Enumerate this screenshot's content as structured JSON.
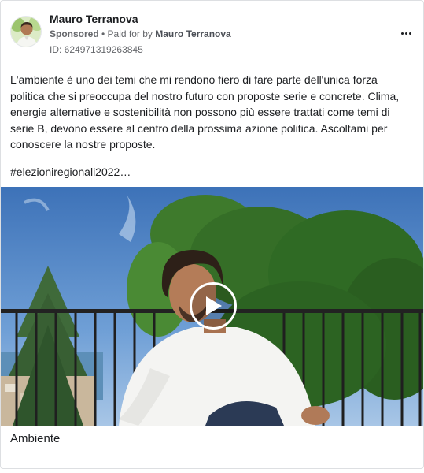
{
  "post": {
    "author_name": "Mauro Terranova",
    "sponsored_label": "Sponsored",
    "paid_for_prefix": " • Paid for by ",
    "payer_name": "Mauro Terranova",
    "ad_id": "ID: 624971319263845",
    "more_icon": "more-horizontal-icon",
    "body_lines": [
      "L'ambiente è uno dei temi che mi rendono fiero di fare parte dell'unica forza",
      "politica che si preoccupa del nostro futuro con proposte serie e concrete. Clima,",
      "energie alternative e sostenibilità non possono più essere trattati come temi di",
      "serie B, devono essere al centro della prossima azione politica. Ascoltami per",
      "conoscere la nostre proposte."
    ],
    "hashtag": "#elezioniregionali2022…",
    "media_icon": "play-icon",
    "caption": "Ambiente"
  }
}
